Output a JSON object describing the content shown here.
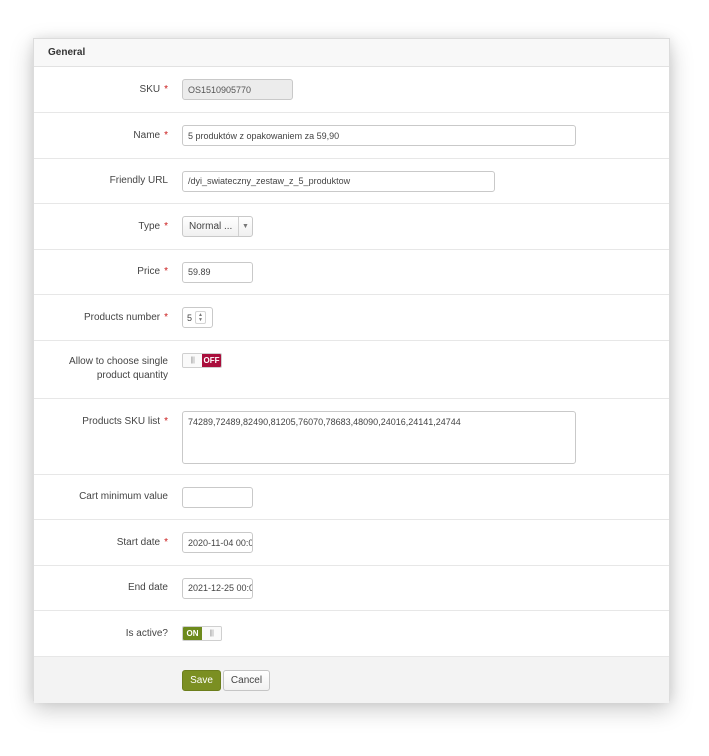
{
  "panel": {
    "title": "General"
  },
  "required_marker": "*",
  "fields": {
    "sku": {
      "label": "SKU",
      "value": "OS1510905770"
    },
    "name": {
      "label": "Name",
      "value": "5 produktów z opakowaniem za 59,90"
    },
    "friendly_url": {
      "label": "Friendly URL",
      "value": "/dyi_swiateczny_zestaw_z_5_produktow"
    },
    "type": {
      "label": "Type",
      "value": "Normal ...",
      "arrow": "▼"
    },
    "price": {
      "label": "Price",
      "value": "59.89"
    },
    "products_number": {
      "label": "Products number",
      "value": "5"
    },
    "allow_single": {
      "label_line1": "Allow to choose single",
      "label_line2": "product quantity",
      "state": "OFF"
    },
    "sku_list": {
      "label": "Products SKU list",
      "value": "74289,72489,82490,81205,76070,78683,48090,24016,24141,24744"
    },
    "cart_min": {
      "label": "Cart minimum value",
      "value": ""
    },
    "start_date": {
      "label": "Start date",
      "value": "2020-11-04 00:0"
    },
    "end_date": {
      "label": "End date",
      "value": "2021-12-25 00:0"
    },
    "is_active": {
      "label": "Is active?",
      "state": "ON"
    }
  },
  "buttons": {
    "save": "Save",
    "cancel": "Cancel"
  },
  "colors": {
    "accent": "#7b8f22",
    "toggle_off": "#a90e3c",
    "toggle_on": "#6d8a1c",
    "required": "#c91818"
  }
}
